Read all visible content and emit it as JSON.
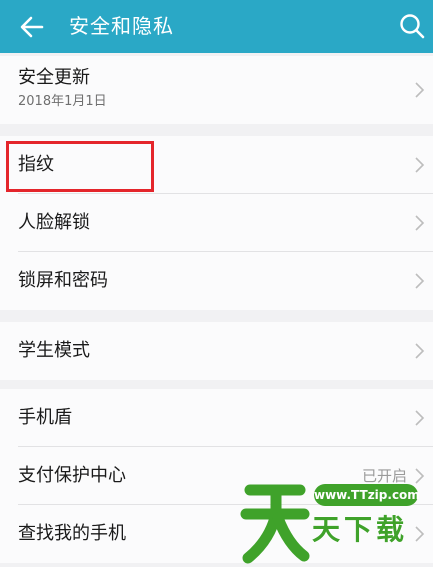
{
  "appbar": {
    "title": "安全和隐私",
    "back_icon": "arrow-left-icon",
    "search_icon": "search-icon",
    "color": "#2aa8c6"
  },
  "groups": [
    {
      "rows": [
        {
          "label": "安全更新",
          "sub": "2018年1月1日"
        }
      ]
    },
    {
      "rows": [
        {
          "label": "指纹"
        },
        {
          "label": "人脸解锁"
        },
        {
          "label": "锁屏和密码"
        }
      ]
    },
    {
      "rows": [
        {
          "label": "学生模式"
        }
      ]
    },
    {
      "rows": [
        {
          "label": "手机盾"
        },
        {
          "label": "支付保护中心",
          "value": "已开启"
        },
        {
          "label": "查找我的手机"
        }
      ]
    }
  ],
  "highlight_color": "#e4252b",
  "watermark": {
    "url": "www.TTzip.com",
    "chars": "天下载",
    "color": "#3fa22a"
  }
}
